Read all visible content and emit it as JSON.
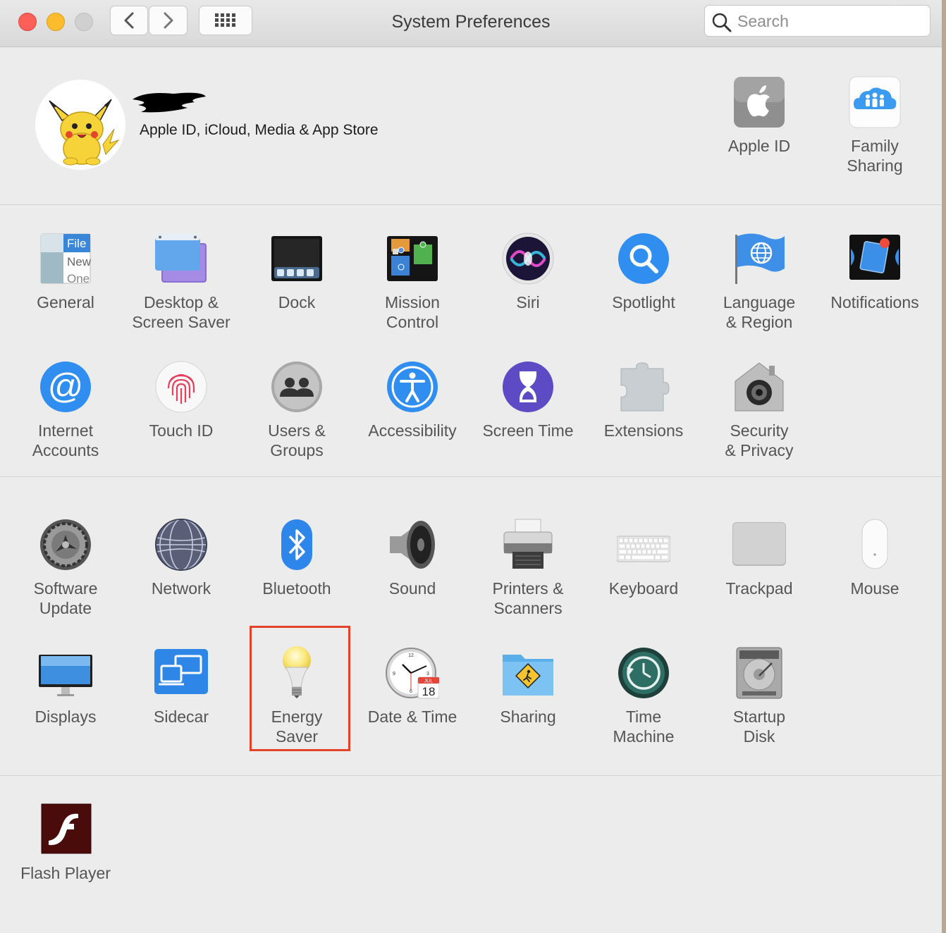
{
  "window": {
    "title": "System Preferences"
  },
  "toolbar": {
    "search_placeholder": "Search"
  },
  "account": {
    "subtitle": "Apple ID, iCloud, Media & App Store"
  },
  "account_shortcuts": [
    {
      "label": "Apple ID",
      "icon": "apple-id-icon"
    },
    {
      "label": "Family\nSharing",
      "icon": "family-sharing-icon"
    }
  ],
  "row1": [
    {
      "label": "General",
      "icon": "general-icon"
    },
    {
      "label": "Desktop &\nScreen Saver",
      "icon": "desktop-screen-saver-icon"
    },
    {
      "label": "Dock",
      "icon": "dock-icon"
    },
    {
      "label": "Mission\nControl",
      "icon": "mission-control-icon"
    },
    {
      "label": "Siri",
      "icon": "siri-icon"
    },
    {
      "label": "Spotlight",
      "icon": "spotlight-icon"
    },
    {
      "label": "Language\n& Region",
      "icon": "language-region-icon"
    },
    {
      "label": "Notifications",
      "icon": "notifications-icon"
    }
  ],
  "row2": [
    {
      "label": "Internet\nAccounts",
      "icon": "internet-accounts-icon"
    },
    {
      "label": "Touch ID",
      "icon": "touch-id-icon"
    },
    {
      "label": "Users &\nGroups",
      "icon": "users-groups-icon"
    },
    {
      "label": "Accessibility",
      "icon": "accessibility-icon"
    },
    {
      "label": "Screen Time",
      "icon": "screen-time-icon"
    },
    {
      "label": "Extensions",
      "icon": "extensions-icon"
    },
    {
      "label": "Security\n& Privacy",
      "icon": "security-privacy-icon"
    }
  ],
  "row3": [
    {
      "label": "Software\nUpdate",
      "icon": "software-update-icon"
    },
    {
      "label": "Network",
      "icon": "network-icon"
    },
    {
      "label": "Bluetooth",
      "icon": "bluetooth-icon"
    },
    {
      "label": "Sound",
      "icon": "sound-icon"
    },
    {
      "label": "Printers &\nScanners",
      "icon": "printers-scanners-icon"
    },
    {
      "label": "Keyboard",
      "icon": "keyboard-icon"
    },
    {
      "label": "Trackpad",
      "icon": "trackpad-icon"
    },
    {
      "label": "Mouse",
      "icon": "mouse-icon"
    }
  ],
  "row4": [
    {
      "label": "Displays",
      "icon": "displays-icon"
    },
    {
      "label": "Sidecar",
      "icon": "sidecar-icon"
    },
    {
      "label": "Energy\nSaver",
      "icon": "energy-saver-icon",
      "highlighted": true
    },
    {
      "label": "Date & Time",
      "icon": "date-time-icon"
    },
    {
      "label": "Sharing",
      "icon": "sharing-icon"
    },
    {
      "label": "Time\nMachine",
      "icon": "time-machine-icon"
    },
    {
      "label": "Startup\nDisk",
      "icon": "startup-disk-icon"
    }
  ],
  "row5": [
    {
      "label": "Flash Player",
      "icon": "flash-player-icon"
    }
  ],
  "general_icon_text": {
    "file": "File",
    "new": "New",
    "one": "One"
  },
  "calendar_icon_text": {
    "month": "JUL",
    "day": "18"
  },
  "highlight_color": "#e2432a"
}
